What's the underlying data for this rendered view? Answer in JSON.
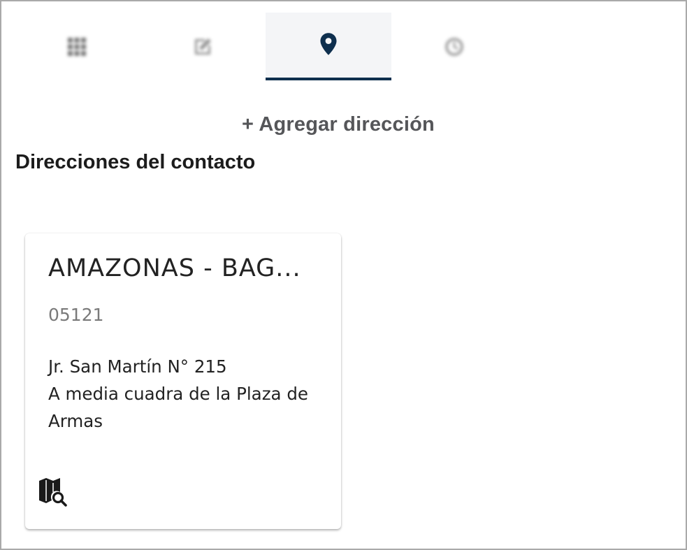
{
  "tabs": [
    {
      "icon": "grid-icon",
      "active": false
    },
    {
      "icon": "edit-note-icon",
      "active": false
    },
    {
      "icon": "location-pin-icon",
      "active": true
    },
    {
      "icon": "history-icon",
      "active": false
    }
  ],
  "add_address_label": "+ Agregar dirección",
  "section_title": "Direcciones del contacto",
  "address_card": {
    "title": "AMAZONAS - BAG...",
    "postal_code": "05121",
    "address_line1": "Jr. San Martín N° 215",
    "address_line2": "A media cuadra de la Plaza de Armas",
    "action_icon": "map-search-icon"
  },
  "colors": {
    "accent": "#0e2f4e",
    "active_tab_bg": "#f4f5f7",
    "muted_text": "#7a7a7a"
  }
}
